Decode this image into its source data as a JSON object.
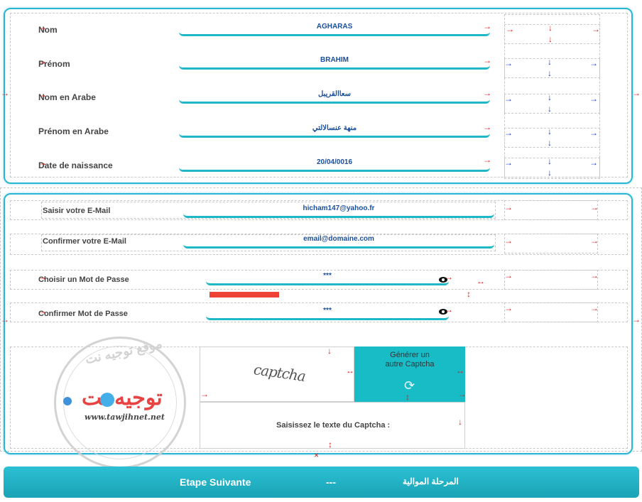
{
  "identity": {
    "nom_label": "Nom",
    "nom_value": "AGHARAS",
    "prenom_label": "Prénom",
    "prenom_value": "BRAHIM",
    "nom_ar_label": "Nom en Arabe",
    "nom_ar_value": "سعاالقريبل",
    "prenom_ar_label": "Prénom en Arabe",
    "prenom_ar_value": "منهة عنسالالتي",
    "dob_label": "Date de naissance",
    "dob_value": "20/04/0016"
  },
  "account": {
    "email_label": "Saisir votre E-Mail",
    "email_value": "hicham147@yahoo.fr",
    "email_confirm_label": "Confirmer votre E-Mail",
    "email_confirm_placeholder": "email@domaine.com",
    "password_label": "Choisir un Mot de Passe",
    "password_value": "***",
    "password_confirm_label": "Confirmer Mot de Passe",
    "password_confirm_value": "***",
    "password_strength": 0.28
  },
  "captcha": {
    "image_text": "captcha",
    "generate_label": "Générer un autre Captcha",
    "input_label": "Saisissez le texte du Captcha :"
  },
  "watermark": {
    "brand_ar": "توجيه نت",
    "ring_text_ar": "موقع توجيه نت",
    "url": "www.tawjihnet.net"
  },
  "footer": {
    "next_fr": "Etape Suivante",
    "separator": "---",
    "next_ar": "المرحلة الموالية"
  },
  "colors": {
    "accent": "#1fb8c7",
    "value_text": "#1a4f9c",
    "strength_bar": "#ef4236",
    "footer": "#1aa3b5"
  },
  "icons": {
    "arrow": "right-arrow-icon",
    "eye": "eye-icon",
    "refresh": "refresh-icon"
  }
}
